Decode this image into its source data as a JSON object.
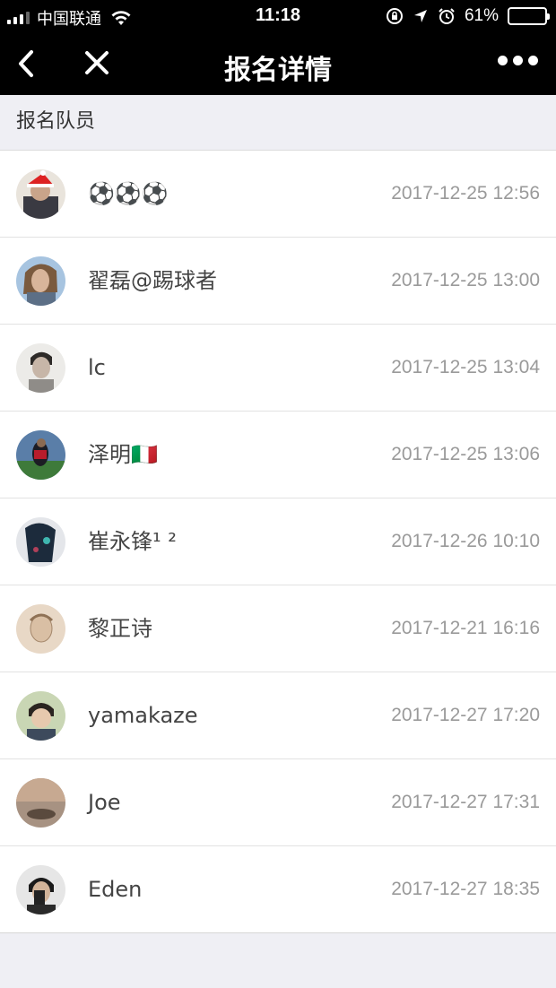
{
  "status_bar": {
    "carrier": "中国联通",
    "time": "11:18",
    "battery_percent": "61%",
    "battery_level": 0.61,
    "icons": [
      "signal-icon",
      "wifi-icon",
      "orientation-lock-icon",
      "location-icon",
      "alarm-icon",
      "battery-icon"
    ]
  },
  "nav": {
    "title": "报名详情",
    "icons": [
      "back-chevron-icon",
      "close-icon",
      "more-icon"
    ]
  },
  "section": {
    "title": "报名队员"
  },
  "members": [
    {
      "name": "⚽⚽⚽",
      "time": "2017-12-25 12:56"
    },
    {
      "name": "翟磊@踢球者",
      "time": "2017-12-25 13:00"
    },
    {
      "name": "lc",
      "time": "2017-12-25 13:04"
    },
    {
      "name": "泽明🇮🇹",
      "time": "2017-12-25 13:06"
    },
    {
      "name": "崔永锋¹ ²",
      "time": "2017-12-26 10:10"
    },
    {
      "name": "黎正诗",
      "time": "2017-12-21 16:16"
    },
    {
      "name": "yamakaze",
      "time": "2017-12-27 17:20"
    },
    {
      "name": "Joe",
      "time": "2017-12-27 17:31"
    },
    {
      "name": "Eden",
      "time": "2017-12-27 18:35"
    }
  ]
}
